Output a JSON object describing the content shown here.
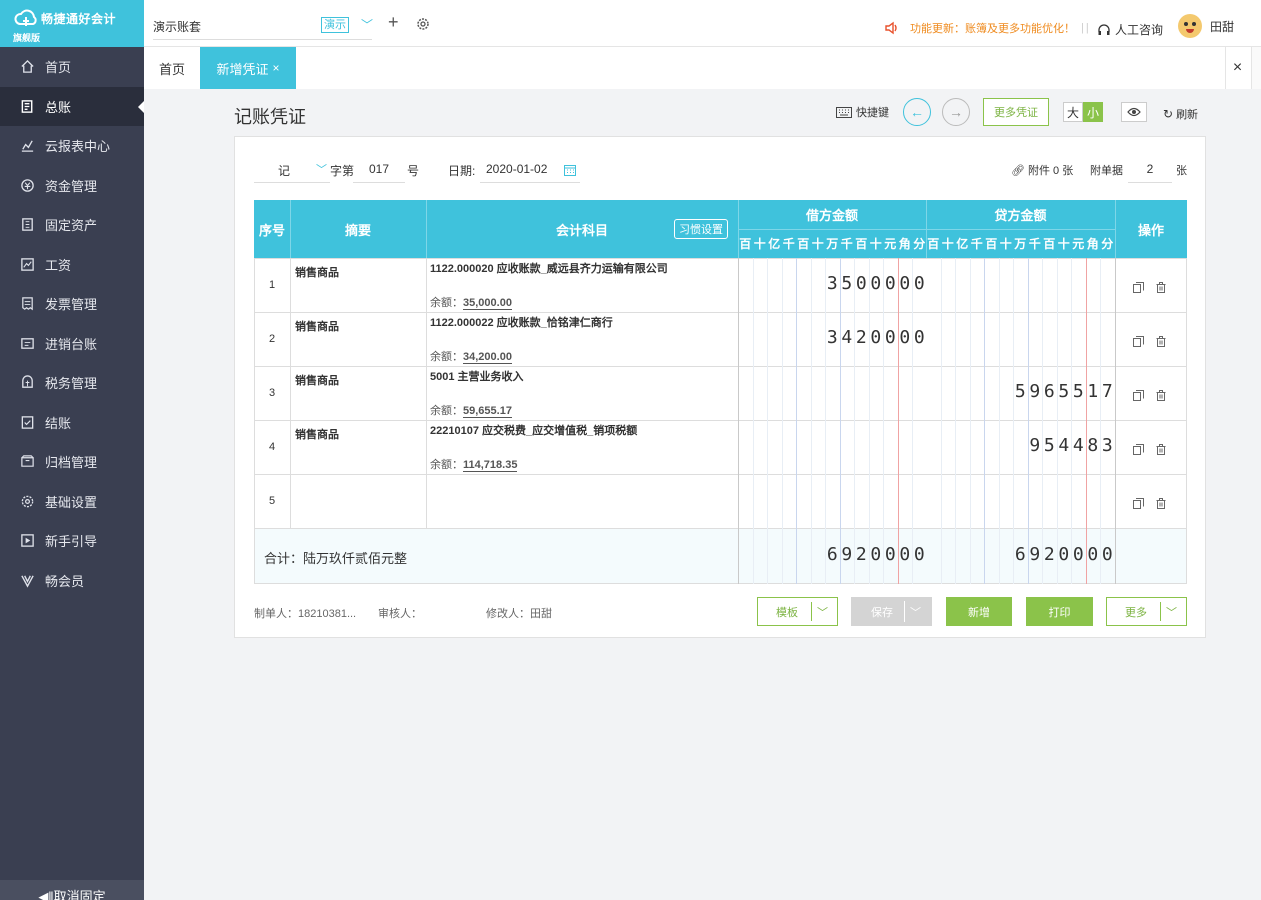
{
  "app": {
    "logo_text": "畅捷通好会计",
    "logo_edition": "旗舰版",
    "account_name": "演示账套",
    "demo_badge": "演示",
    "notice": "功能更新：账簿及更多功能优化！",
    "support": "人工咨询",
    "user_name": "田甜"
  },
  "sidebar": {
    "items": [
      {
        "label": "首页",
        "icon": "home-icon"
      },
      {
        "label": "总账",
        "icon": "ledger-icon",
        "active": true
      },
      {
        "label": "云报表中心",
        "icon": "chart-icon"
      },
      {
        "label": "资金管理",
        "icon": "money-icon"
      },
      {
        "label": "固定资产",
        "icon": "asset-icon"
      },
      {
        "label": "工资",
        "icon": "salary-icon"
      },
      {
        "label": "发票管理",
        "icon": "invoice-icon"
      },
      {
        "label": "进销台账",
        "icon": "inventory-icon"
      },
      {
        "label": "税务管理",
        "icon": "tax-icon"
      },
      {
        "label": "结账",
        "icon": "close-book-icon"
      },
      {
        "label": "归档管理",
        "icon": "archive-icon"
      },
      {
        "label": "基础设置",
        "icon": "settings-icon"
      },
      {
        "label": "新手引导",
        "icon": "guide-icon"
      },
      {
        "label": "畅会员",
        "icon": "vip-icon"
      }
    ],
    "unpin_label": "◀‖取消固定"
  },
  "tabs": {
    "home": "首页",
    "active": "新增凭证",
    "active_close": "×",
    "close_all": "×"
  },
  "toolbar": {
    "title": "记账凭证",
    "shortcut": "快捷键",
    "more_voucher": "更多凭证",
    "size_big": "大",
    "size_small": "小",
    "refresh": "刷新"
  },
  "voucher": {
    "type": "记",
    "word_label": "字第",
    "number": "017",
    "number_suffix": "号",
    "date_label": "日期:",
    "date": "2020-01-02",
    "attachment": "附件 0 张",
    "doc_label": "附单据",
    "doc_count": "2",
    "doc_suffix": "张"
  },
  "table": {
    "headers": {
      "index": "序号",
      "summary": "摘要",
      "account": "会计科目",
      "habit": "习惯设置",
      "debit": "借方金额",
      "credit": "贷方金额",
      "ops": "操作"
    },
    "digit_units": [
      "百",
      "十",
      "亿",
      "千",
      "百",
      "十",
      "万",
      "千",
      "百",
      "十",
      "元",
      "角",
      "分"
    ],
    "rows": [
      {
        "no": "1",
        "summary": "销售商品",
        "account": "1122.000020 应收账款_威远县齐力运输有限公司",
        "balance_label": "余额：",
        "balance": "35,000.00",
        "debit": "3500000",
        "credit": ""
      },
      {
        "no": "2",
        "summary": "销售商品",
        "account": "1122.000022 应收账款_恰铭津仁商行",
        "balance_label": "余额：",
        "balance": "34,200.00",
        "debit": "3420000",
        "credit": ""
      },
      {
        "no": "3",
        "summary": "销售商品",
        "account": "5001 主营业务收入",
        "balance_label": "余额：",
        "balance": "59,655.17",
        "debit": "",
        "credit": "5965517"
      },
      {
        "no": "4",
        "summary": "销售商品",
        "account": "22210107 应交税费_应交增值税_销项税额",
        "balance_label": "余额：",
        "balance": "114,718.35",
        "debit": "",
        "credit": "954483"
      },
      {
        "no": "5",
        "summary": "",
        "account": "",
        "balance_label": "",
        "balance": "",
        "debit": "",
        "credit": ""
      }
    ],
    "total_label": "合计：陆万玖仟贰佰元整",
    "total_debit": "6920000",
    "total_credit": "6920000"
  },
  "footer": {
    "maker": "制单人：18210381...",
    "reviewer": "审核人：",
    "modifier": "修改人：田甜",
    "template_btn": "模板",
    "save_btn": "保存",
    "new_btn": "新增",
    "print_btn": "打印",
    "more_btn": "更多"
  },
  "colors": {
    "accent": "#3fc2dc",
    "green": "#8bc34a",
    "sidebar_bg": "#3a3f51",
    "notice": "#ef8b1f"
  }
}
